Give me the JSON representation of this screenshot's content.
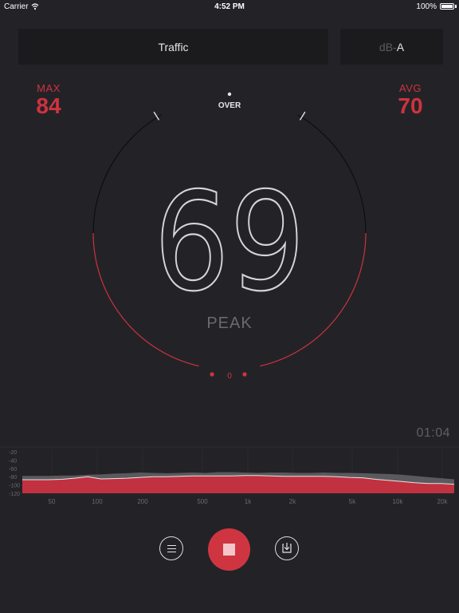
{
  "status_bar": {
    "carrier": "Carrier",
    "time": "4:52 PM",
    "battery": "100%",
    "battery_level": 1.0
  },
  "preset": {
    "label": "Traffic"
  },
  "weighting": {
    "prefix": "dB-",
    "curve": "A"
  },
  "max": {
    "label": "MAX",
    "value": "84"
  },
  "avg": {
    "label": "AVG",
    "value": "70"
  },
  "gauge": {
    "over_label": "OVER",
    "zero_label": "0",
    "reading": "69",
    "reading_label": "PEAK",
    "level_fraction": 0.76,
    "colors": {
      "track": "#0e0e10",
      "active": "#cf3541",
      "reading": "#d5d5d7"
    }
  },
  "timer": "01:04",
  "spectrum": {
    "db_ticks": [
      "-20",
      "-40",
      "-60",
      "-80",
      "-100",
      "-120"
    ],
    "freq_ticks": [
      "50",
      "100",
      "200",
      "500",
      "1k",
      "2k",
      "5k",
      "10k",
      "20k"
    ],
    "peak_db": [
      -79,
      -79,
      -79,
      -78,
      -78,
      -76,
      -75,
      -73,
      -72,
      -70,
      -71,
      -72,
      -71,
      -70,
      -71,
      -69,
      -69,
      -70,
      -71,
      -70,
      -70,
      -71,
      -71,
      -70,
      -71,
      -71,
      -72,
      -73,
      -74,
      -76,
      -79,
      -82,
      -85,
      -88
    ],
    "level_db": [
      -89,
      -89,
      -89,
      -88,
      -85,
      -81,
      -87,
      -86,
      -85,
      -83,
      -81,
      -81,
      -80,
      -79,
      -79,
      -79,
      -79,
      -78,
      -78,
      -79,
      -80,
      -80,
      -80,
      -80,
      -81,
      -83,
      -84,
      -88,
      -91,
      -94,
      -97,
      -99,
      -99,
      -101
    ],
    "colors": {
      "peak": "#5a5a5e",
      "level": "#c23140",
      "line": "#e6e6e6"
    }
  },
  "controls": {
    "list_icon": "list-icon",
    "stop_icon": "stop-icon",
    "export_icon": "export-icon"
  }
}
